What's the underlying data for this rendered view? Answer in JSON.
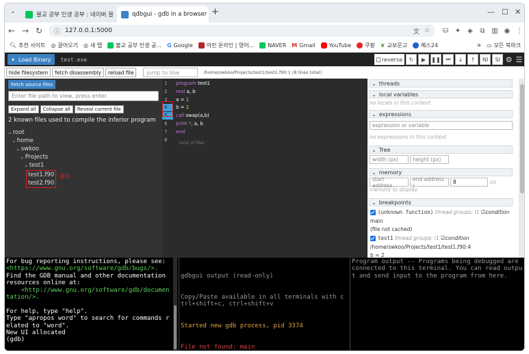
{
  "browser": {
    "tabs": [
      {
        "label": "불교 공부 인생 공부 : 네이버 블"
      },
      {
        "label": "qdbgui - gdb in a browser"
      }
    ],
    "new_tab": "+",
    "url": "127.0.0.1:5000",
    "bookmarks": [
      {
        "label": "추천 사이트",
        "icon": "search-icon"
      },
      {
        "label": "끌어오기",
        "icon": "globe-icon"
      },
      {
        "label": "새 탭",
        "icon": "globe-icon"
      },
      {
        "label": "불교 공부 인생 공...",
        "icon": "naver-blog-icon"
      },
      {
        "label": "Google",
        "icon": "google-icon"
      },
      {
        "label": "어린 온라인 | 영어...",
        "icon": "bookmark-icon"
      },
      {
        "label": "NAVER",
        "icon": "naver-icon"
      },
      {
        "label": "Gmail",
        "icon": "gmail-icon"
      },
      {
        "label": "YouTube",
        "icon": "youtube-icon"
      },
      {
        "label": "쿠팡",
        "icon": "coupang-icon"
      },
      {
        "label": "교보문고",
        "icon": "kyobo-icon"
      },
      {
        "label": "예스24",
        "icon": "yes24-icon"
      }
    ],
    "all_bookmarks": "모든 북마크",
    "more": "»"
  },
  "app": {
    "load_binary": "Load Binary",
    "binary_path": "test.exe",
    "reverse": "reverse",
    "ni": "NI",
    "si": "SI",
    "buttons": {
      "hide_fs": "hide filesystem",
      "fetch_disasm": "fetch disassembly",
      "reload": "reload file"
    },
    "jump_placeholder": "jump to line",
    "file_path_info": "/home/swkoo/Projects/test1/test1.f90:1 (8 lines total)"
  },
  "left": {
    "fetch_sources": "Fetch source files",
    "file_input_placeholder": "Enter file path to view, press enter",
    "expand_all": "Expand all",
    "collapse_all": "Collapse all",
    "reveal": "Reveal current file",
    "known_files": "2 known files used to compile the inferior program",
    "tree": {
      "root": "root",
      "home": "home",
      "swkoo": "swkoo",
      "projects": "Projects",
      "test1": "test1",
      "f1": "test1.f90",
      "f2": "test2.f90"
    },
    "annotation": "클릭"
  },
  "code": {
    "lines": [
      {
        "n": "1",
        "parts": [
          [
            "kw",
            "program"
          ],
          [
            "",
            "  test1"
          ]
        ]
      },
      {
        "n": "2",
        "parts": [
          [
            "kw",
            "real"
          ],
          [
            "",
            "  a, b"
          ]
        ]
      },
      {
        "n": "3",
        "parts": [
          [
            "",
            "a = "
          ],
          [
            "fn",
            "1"
          ]
        ]
      },
      {
        "n": "4",
        "parts": [
          [
            "",
            "b = "
          ],
          [
            "fn",
            "2"
          ]
        ]
      },
      {
        "n": "5",
        "parts": [
          [
            "kw",
            "call"
          ],
          [
            "",
            "  swap(a,b)"
          ]
        ]
      },
      {
        "n": "6",
        "parts": [
          [
            "kw",
            "print"
          ],
          [
            "str",
            " *"
          ],
          [
            "",
            ", a, b"
          ]
        ]
      },
      {
        "n": "7",
        "parts": [
          [
            "kw",
            "end"
          ]
        ]
      },
      {
        "n": "8",
        "parts": []
      }
    ],
    "eof": "(end of file)"
  },
  "right": {
    "threads": "threads",
    "locals": "local variables",
    "no_locals": "no locals in this context",
    "expressions": "expressions",
    "expr_placeholder": "expression or variable",
    "no_expr": "no expressions in this context",
    "tree": "Tree",
    "width_ph": "width (px)",
    "height_ph": "height (px)",
    "memory": "memory",
    "start_ph": "start address",
    "end_ph": "end address (",
    "mem_val": "8",
    "mem_unit": "xo",
    "mem_display": "memory to display",
    "breakpoints": "breakpoints",
    "bp1": {
      "func": "(unknown function)",
      "tg": "thread groups: i1",
      "cond": "condition",
      "loc": "main",
      "note": "(file not cached)"
    },
    "bp2": {
      "func": "test1",
      "tg": "thread groups: i1",
      "cond": "condition",
      "loc": "/home/swkoo/Projects/test1/test1.f90:4",
      "code": "b = 2"
    }
  },
  "terminals": {
    "gdb": [
      "For bug reporting instructions, please see:",
      "<https://www.gnu.org/software/gdb/bugs/>.",
      "Find the GDB manual and other documentation resources online at:",
      "    <http://www.gnu.org/software/gdb/documentation/>.",
      "",
      "For help, type \"help\".",
      "Type \"apropos word\" to search for commands related to \"word\".",
      "New UI allocated",
      "(gdb)"
    ],
    "gdbgui_header": "gdbgui output (read-only)",
    "gdbgui_copy": "Copy/Paste available in all terminals with ctrl+shift+c, ctrl+shift+v",
    "gdbgui_started": "Started new gdb process, pid 3374",
    "gdbgui_error": "File not found: main",
    "program_output": "Program output -- Programs being debugged are connected to this terminal. You can read output and send input to the program from here."
  }
}
